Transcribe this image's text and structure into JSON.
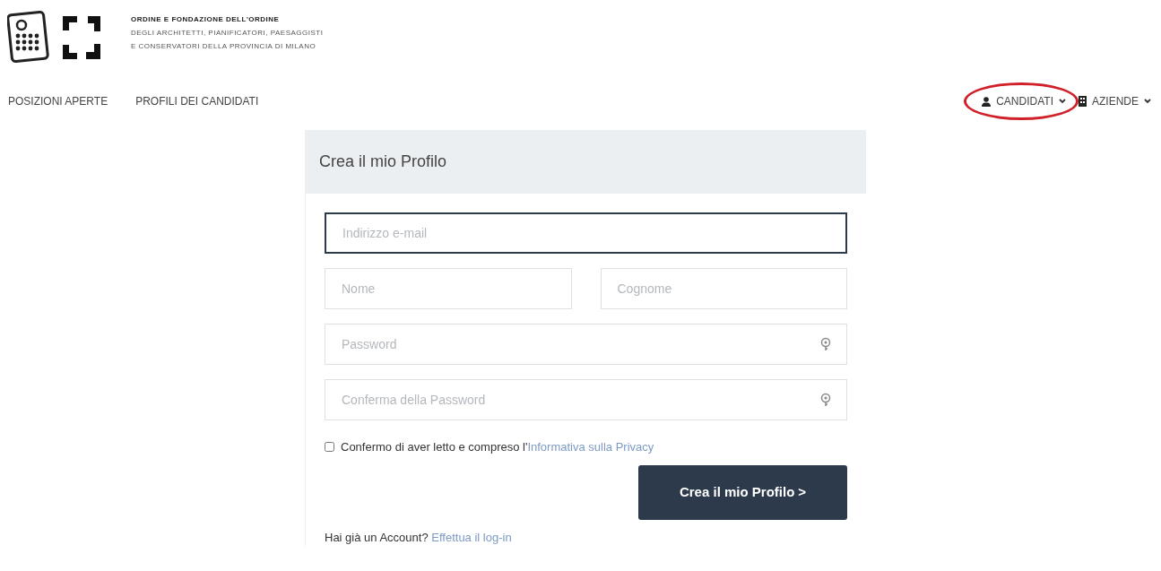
{
  "header": {
    "org_lines": [
      "ORDINE E FONDAZIONE DELL'ORDINE",
      "DEGLI ARCHITETTI, PIANIFICATORI, PAESAGGISTI",
      "E CONSERVATORI DELLA PROVINCIA DI MILANO"
    ]
  },
  "nav": {
    "left": [
      "POSIZIONI APERTE",
      "PROFILI DEI CANDIDATI"
    ],
    "right": [
      {
        "label": "CANDIDATI",
        "kind": "person",
        "circled": true
      },
      {
        "label": "AZIENDE",
        "kind": "building",
        "circled": false
      }
    ]
  },
  "form": {
    "title": "Crea il mio Profilo",
    "email": {
      "placeholder": "Indirizzo e-mail",
      "focused": true
    },
    "first_name": {
      "placeholder": "Nome"
    },
    "last_name": {
      "placeholder": "Cognome"
    },
    "password": {
      "placeholder": "Password"
    },
    "confirm_password": {
      "placeholder": "Conferma della Password"
    },
    "privacy": {
      "checked": false,
      "text": "Confermo di aver letto e compreso l'",
      "link": "Informativa sulla Privacy"
    },
    "submit": {
      "label": "Crea il mio Profilo",
      "arrow": ">"
    },
    "login": {
      "text": "Hai già un Account?",
      "link": "Effettua il log-in"
    }
  }
}
